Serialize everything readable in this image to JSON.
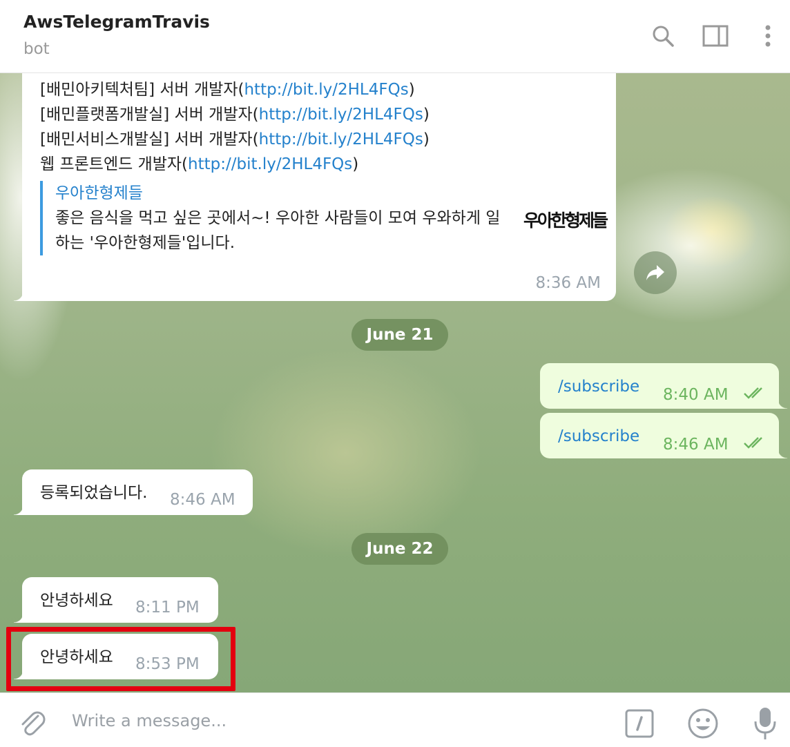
{
  "header": {
    "title": "AwsTelegramTravis",
    "subtitle": "bot"
  },
  "messages": {
    "m1": {
      "lines": [
        {
          "text": "[배민아키텍처팀] 서버 개발자(",
          "link": "http://bit.ly/2HL4FQs",
          "tail": ")"
        },
        {
          "text": "[배민플랫폼개발실] 서버 개발자(",
          "link": "http://bit.ly/2HL4FQs",
          "tail": ")"
        },
        {
          "text": "[배민서비스개발실] 서버 개발자(",
          "link": "http://bit.ly/2HL4FQs",
          "tail": ")"
        },
        {
          "text": "웹 프론트엔드 개발자(",
          "link": "http://bit.ly/2HL4FQs",
          "tail": ")"
        }
      ],
      "preview": {
        "title": "우아한형제들",
        "text": "좋은 음식을 먹고 싶은 곳에서~! 우아한 사람들이 모여 우와하게 일하는 '우아한형제들'입니다.",
        "logo": "우아한형제들"
      },
      "time": "8:36 AM"
    },
    "date1": "June 21",
    "m2": {
      "text": "/subscribe",
      "time": "8:40 AM"
    },
    "m3": {
      "text": "/subscribe",
      "time": "8:46 AM"
    },
    "m4": {
      "text": "등록되었습니다.",
      "time": "8:46 AM"
    },
    "date2": "June 22",
    "m5": {
      "text": "안녕하세요",
      "time": "8:11 PM"
    },
    "m6": {
      "text": "안녕하세요",
      "time": "8:53 PM"
    }
  },
  "composer": {
    "placeholder": "Write a message..."
  },
  "icons": {
    "header": [
      "search-icon",
      "sidebar-toggle-icon",
      "more-vertical-icon"
    ],
    "composer": [
      "attach-icon",
      "bot-command-icon",
      "emoji-icon",
      "microphone-icon"
    ],
    "share": "share-icon",
    "read_status": "double-check-icon"
  },
  "colors": {
    "link": "#2481cc",
    "outgoing_bubble": "#effdde",
    "outgoing_time": "#6cb55f",
    "highlight": "#e3000f"
  }
}
